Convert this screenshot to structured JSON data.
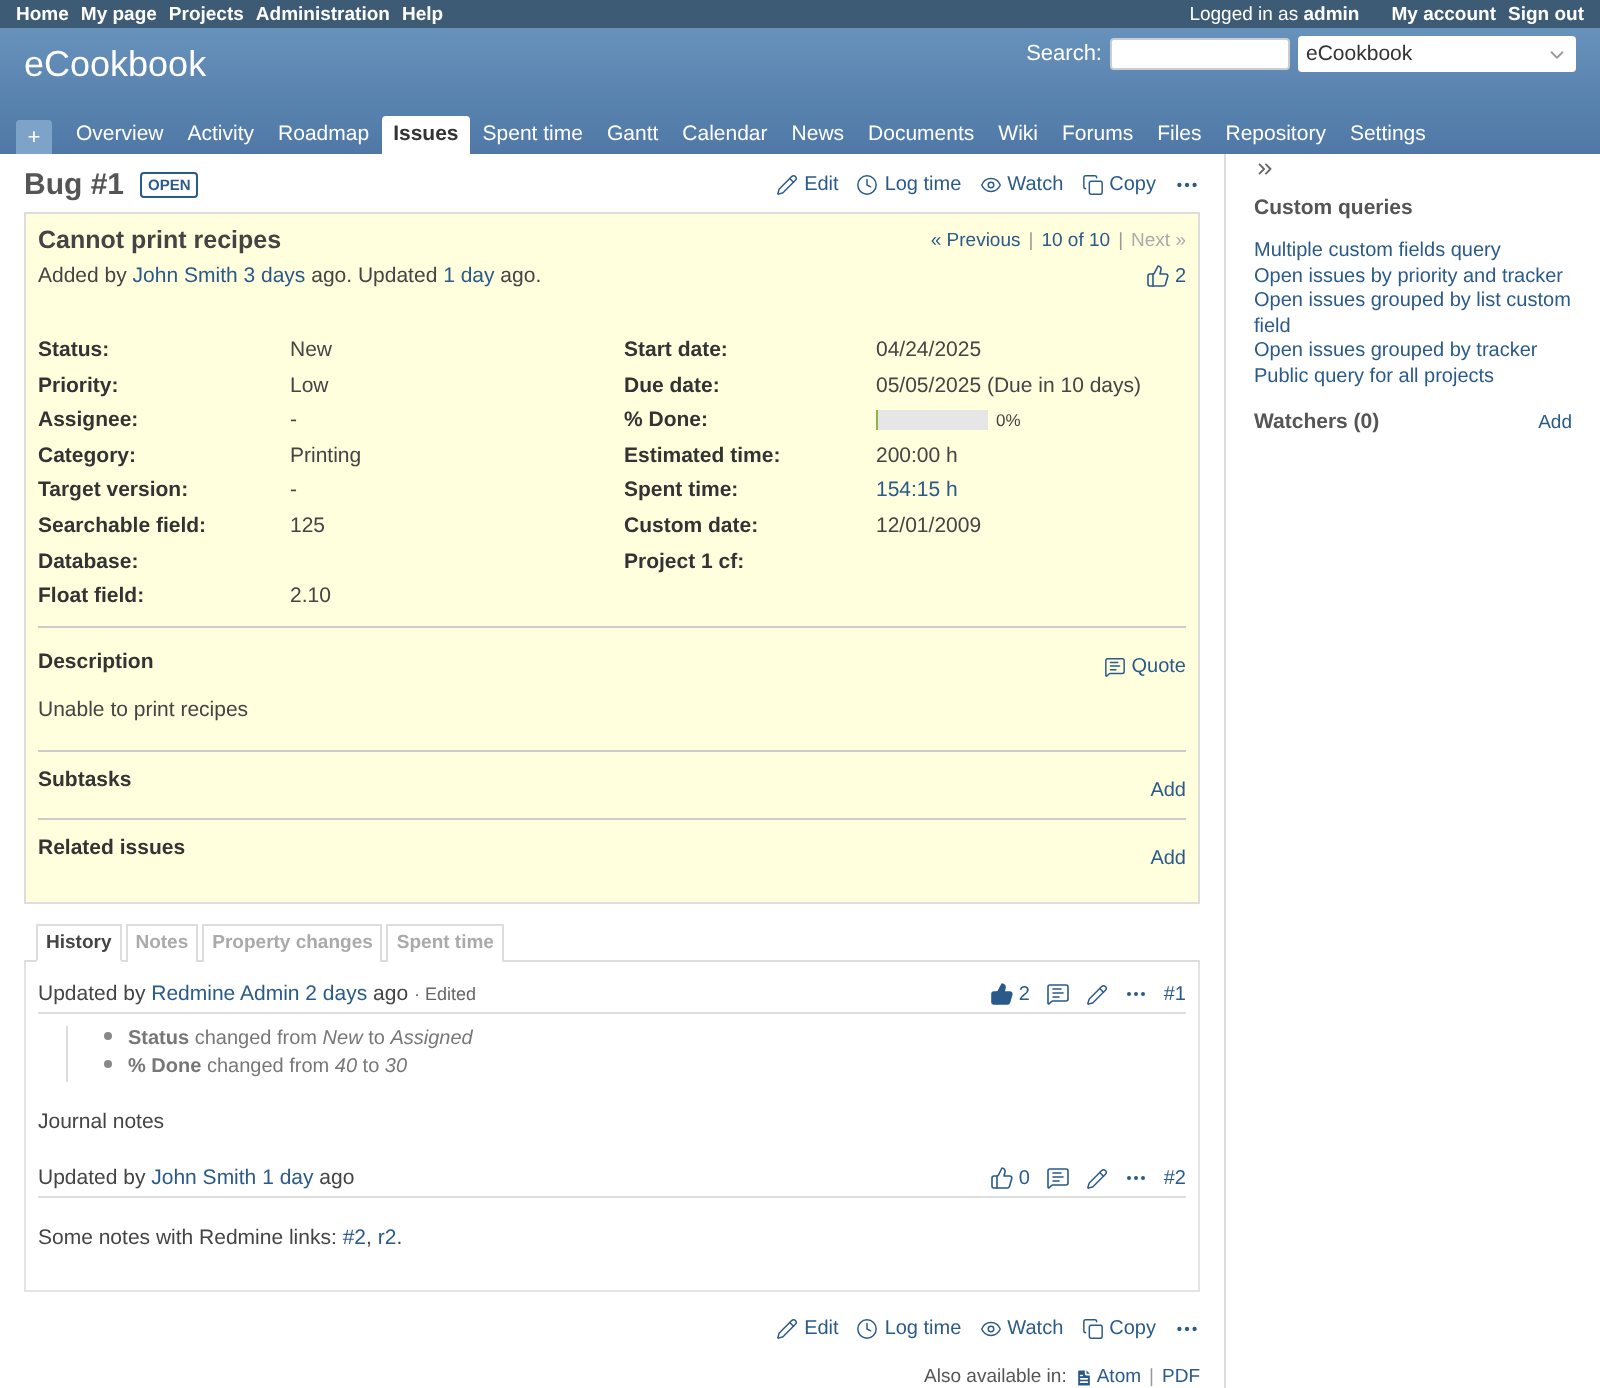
{
  "top_menu": [
    "Home",
    "My page",
    "Projects",
    "Administration",
    "Help"
  ],
  "account": {
    "prefix": "Logged in as",
    "user": "admin",
    "links": [
      "My account",
      "Sign out"
    ]
  },
  "header": {
    "project": "eCookbook",
    "search_label": "Search:",
    "project_select": "eCookbook"
  },
  "new_button": "+",
  "main_tabs": [
    {
      "label": "Overview",
      "selected": false
    },
    {
      "label": "Activity",
      "selected": false
    },
    {
      "label": "Roadmap",
      "selected": false
    },
    {
      "label": "Issues",
      "selected": true
    },
    {
      "label": "Spent time",
      "selected": false
    },
    {
      "label": "Gantt",
      "selected": false
    },
    {
      "label": "Calendar",
      "selected": false
    },
    {
      "label": "News",
      "selected": false
    },
    {
      "label": "Documents",
      "selected": false
    },
    {
      "label": "Wiki",
      "selected": false
    },
    {
      "label": "Forums",
      "selected": false
    },
    {
      "label": "Files",
      "selected": false
    },
    {
      "label": "Repository",
      "selected": false
    },
    {
      "label": "Settings",
      "selected": false
    }
  ],
  "issue": {
    "title": "Bug #1",
    "status_badge": "OPEN",
    "actions": [
      {
        "kind": "edit",
        "label": "Edit"
      },
      {
        "kind": "log_time",
        "label": "Log time"
      },
      {
        "kind": "watch",
        "label": "Watch"
      },
      {
        "kind": "copy",
        "label": "Copy"
      }
    ],
    "subject": "Cannot print recipes",
    "nav": {
      "previous": "« Previous",
      "separator": "|",
      "position": "10 of 10",
      "next": "Next »",
      "next_disabled": true
    },
    "author_line": [
      {
        "text": "Added by "
      },
      {
        "text": "John Smith",
        "link": true
      },
      {
        "text": "3 days",
        "link": true
      },
      {
        "text": " ago. Updated "
      },
      {
        "text": "1 day",
        "link": true
      },
      {
        "text": " ago."
      }
    ],
    "reactions": {
      "count": "2",
      "reacted": false
    },
    "attributes_left": [
      {
        "label": "Status:",
        "value": "New",
        "kind": "text"
      },
      {
        "label": "Priority:",
        "value": "Low",
        "kind": "text"
      },
      {
        "label": "Assignee:",
        "value": "-",
        "kind": "text"
      },
      {
        "label": "Category:",
        "value": "Printing",
        "kind": "text"
      },
      {
        "label": "Target version:",
        "value": "-",
        "kind": "text"
      },
      {
        "label": "Searchable field:",
        "value": "125",
        "kind": "text"
      },
      {
        "label": "Database:",
        "kind": "text"
      },
      {
        "label": "Float field:",
        "value": "2.10",
        "kind": "text"
      }
    ],
    "attributes_right": [
      {
        "label": "Start date:",
        "value": "04/24/2025",
        "kind": "text"
      },
      {
        "label": "Due date:",
        "value": "05/05/2025 (Due in 10 days)",
        "kind": "text"
      },
      {
        "label": "% Done:",
        "value": "0%",
        "kind": "progress",
        "level": 0
      },
      {
        "label": "Estimated time:",
        "value": "200:00 h",
        "kind": "text"
      },
      {
        "label": "Spent time:",
        "value": "154:15 h",
        "kind": "link"
      },
      {
        "label": "Custom date:",
        "value": "12/01/2009",
        "kind": "text"
      },
      {
        "label": "Project 1 cf:",
        "kind": "text"
      }
    ],
    "description": {
      "label": "Description",
      "quote": "Quote",
      "text": "Unable to print recipes"
    },
    "sections": [
      {
        "label": "Subtasks",
        "action": "Add"
      },
      {
        "label": "Related issues",
        "action": "Add"
      }
    ]
  },
  "history_tabs": [
    {
      "label": "History",
      "selected": true
    },
    {
      "label": "Notes",
      "selected": false
    },
    {
      "label": "Property changes",
      "selected": false
    },
    {
      "label": "Spent time",
      "selected": false
    }
  ],
  "journals": [
    {
      "header": [
        {
          "text": "Updated by "
        },
        {
          "text": "Redmine Admin",
          "link": true
        },
        {
          "text": "2 days",
          "link": true
        },
        {
          "text": " ago"
        }
      ],
      "edited": "· Edited",
      "reactions": {
        "count": "2",
        "reacted": true
      },
      "number": "#1",
      "details": [
        "**Status** changed from *New* to *Assigned*",
        "**% Done** changed from *40* to *30*"
      ],
      "notes": [
        {
          "text": "Journal notes"
        }
      ]
    },
    {
      "header": [
        {
          "text": "Updated by "
        },
        {
          "text": "John Smith",
          "link": true
        },
        {
          "text": "1 day",
          "link": true
        },
        {
          "text": " ago"
        }
      ],
      "reactions": {
        "count": "0",
        "reacted": false
      },
      "number": "#2",
      "notes": [
        {
          "text": "Some notes with Redmine links: "
        },
        {
          "text": "#2",
          "link": true
        },
        {
          "text": ", "
        },
        {
          "text": "r2",
          "link": true
        },
        {
          "text": "."
        }
      ]
    }
  ],
  "bottom_actions": [
    {
      "kind": "edit",
      "label": "Edit"
    },
    {
      "kind": "log_time",
      "label": "Log time"
    },
    {
      "kind": "watch",
      "label": "Watch"
    },
    {
      "kind": "copy",
      "label": "Copy"
    }
  ],
  "other_formats": {
    "label": "Also available in:",
    "separator": "|",
    "formats": [
      "Atom",
      "PDF"
    ]
  },
  "sidebar": {
    "queries_title": "Custom queries",
    "queries": [
      "Multiple custom fields query",
      "Open issues by priority and tracker",
      "Open issues grouped by list custom field",
      "Open issues grouped by tracker",
      "Public query for all projects"
    ],
    "watchers_title": "Watchers (0)",
    "watchers_add": "Add"
  }
}
